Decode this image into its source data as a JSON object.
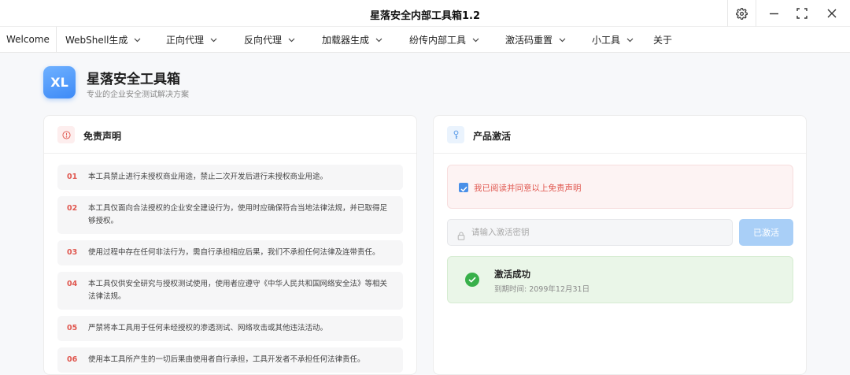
{
  "window": {
    "title": "星落安全内部工具箱1.2"
  },
  "menu": {
    "welcome": "Welcome",
    "items": [
      {
        "label": "WebShell生成"
      },
      {
        "label": "正向代理"
      },
      {
        "label": "反向代理"
      },
      {
        "label": "加载器生成"
      },
      {
        "label": "纷传内部工具"
      },
      {
        "label": "激活码重置"
      },
      {
        "label": "小工具"
      },
      {
        "label": "关于"
      }
    ]
  },
  "header": {
    "logo_text": "XL",
    "app_name": "星落安全工具箱",
    "subtitle": "专业的企业安全测试解决方案"
  },
  "disclaimer": {
    "title": "免责声明",
    "items": [
      {
        "num": "01",
        "text": "本工具禁止进行未授权商业用途，禁止二次开发后进行未授权商业用途。"
      },
      {
        "num": "02",
        "text": "本工具仅面向合法授权的企业安全建设行为，使用时应确保符合当地法律法规，并已取得足够授权。"
      },
      {
        "num": "03",
        "text": "使用过程中存在任何非法行为，需自行承担相应后果，我们不承担任何法律及连带责任。"
      },
      {
        "num": "04",
        "text": "本工具仅供安全研究与授权测试使用，使用者应遵守《中华人民共和国网络安全法》等相关法律法规。"
      },
      {
        "num": "05",
        "text": "严禁将本工具用于任何未经授权的渗透测试、网络攻击或其他违法活动。"
      },
      {
        "num": "06",
        "text": "使用本工具所产生的一切后果由使用者自行承担，工具开发者不承担任何法律责任。"
      }
    ]
  },
  "activation": {
    "title": "产品激活",
    "agree_label": "我已阅读并同意以上免责声明",
    "agree_checked": true,
    "key_placeholder": "请输入激活密钥",
    "key_value": "",
    "button_label": "已激活",
    "success_title": "激活成功",
    "success_expire": "到期时间: 2099年12月31日"
  },
  "colors": {
    "accent": "#3d8af7",
    "danger": "#e0574f",
    "success": "#38b04a",
    "button_disabled": "#a9cff7"
  },
  "icons": {
    "settings": "gear-icon",
    "minimize": "minimize-icon",
    "maximize": "maximize-icon",
    "close": "close-icon",
    "disclaimer": "info-circle-icon",
    "activation": "key-icon",
    "input": "lock-icon",
    "success": "check-circle-icon"
  }
}
